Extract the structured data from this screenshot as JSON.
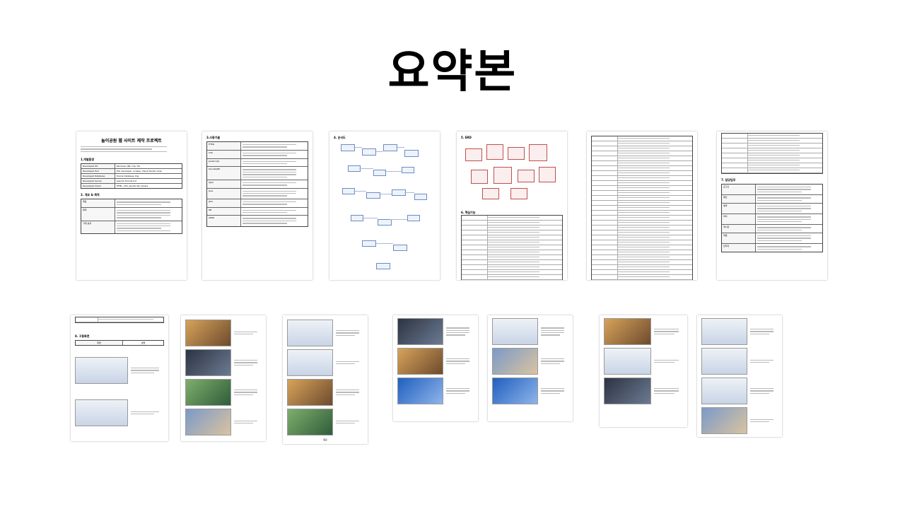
{
  "header": {
    "title": "요약본"
  },
  "doc": {
    "page1_title": "놀이공원 웹 사이트 제작 프로젝트",
    "section_dev_env": "1.개발환경",
    "section_overview": "2. 개요 & 목적",
    "section_tech": "3.사용기술",
    "section_flow": "4. 순서도",
    "section_erd": "5. ERD",
    "section_features": "6. 핵심기능",
    "section_roles": "7. 담당업무",
    "section_screens": "8. 구동화면",
    "dev_env": [
      {
        "k": "Developed OS",
        "v": "Windows x86, mac OS"
      },
      {
        "k": "Developed Tool",
        "v": "SQL developer, eclipse, Visual Studio Code"
      },
      {
        "k": "Developed Database",
        "v": "Oracle Database 11g"
      },
      {
        "k": "Developed Server",
        "v": "Apache Tomcat 9.0"
      },
      {
        "k": "Developed Client",
        "v": "HTML, CSS, JavaScript, jQuery"
      }
    ],
    "overview_rows": [
      "목표",
      "목적",
      "기대 효과"
    ],
    "tech_rows": [
      "HTML",
      "CSS",
      "JavaScript",
      "Servlet/JSP",
      "AJAX",
      "Java",
      "JSTL",
      "DB",
      "eERD"
    ],
    "roles_rows": [
      "로그인",
      "메인",
      "예약",
      "마이",
      "게시판",
      "회원",
      "관리자"
    ],
    "screen_headers": [
      "화면",
      "설명"
    ],
    "final_label": "종료"
  }
}
